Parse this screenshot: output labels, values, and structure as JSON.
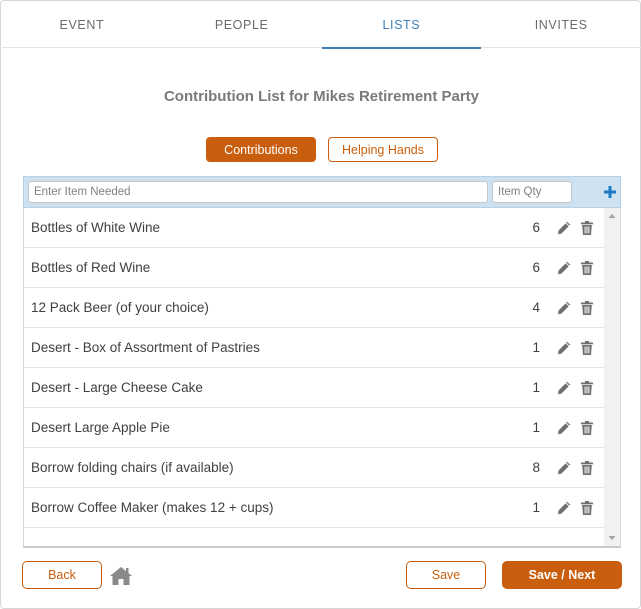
{
  "tabs": [
    {
      "label": "EVENT",
      "active": false
    },
    {
      "label": "PEOPLE",
      "active": false
    },
    {
      "label": "LISTS",
      "active": true
    },
    {
      "label": "INVITES",
      "active": false
    }
  ],
  "page_title": "Contribution List for Mikes Retirement Party",
  "toggles": {
    "contributions_label": "Contributions",
    "helping_hands_label": "Helping Hands"
  },
  "entry": {
    "item_placeholder": "Enter Item Needed",
    "qty_placeholder": "Item Qty",
    "add_icon": "plus-icon"
  },
  "items": [
    {
      "name": "Bottles of White Wine",
      "qty": "6"
    },
    {
      "name": "Bottles of Red Wine",
      "qty": "6"
    },
    {
      "name": "12 Pack Beer (of your choice)",
      "qty": "4"
    },
    {
      "name": "Desert - Box of Assortment of Pastries",
      "qty": "1"
    },
    {
      "name": "Desert - Large Cheese Cake",
      "qty": "1"
    },
    {
      "name": "Desert Large Apple Pie",
      "qty": "1"
    },
    {
      "name": "Borrow folding chairs (if available)",
      "qty": "8"
    },
    {
      "name": "Borrow Coffee Maker (makes 12 + cups)",
      "qty": "1"
    }
  ],
  "footer": {
    "back_label": "Back",
    "save_label": "Save",
    "save_next_label": "Save / Next"
  },
  "colors": {
    "accent": "#c95f0e",
    "tab_active": "#3f7fb5",
    "entry_bar": "#cfe2f1",
    "add_icon": "#1f79c4",
    "row_icon": "#6e6e6e"
  }
}
